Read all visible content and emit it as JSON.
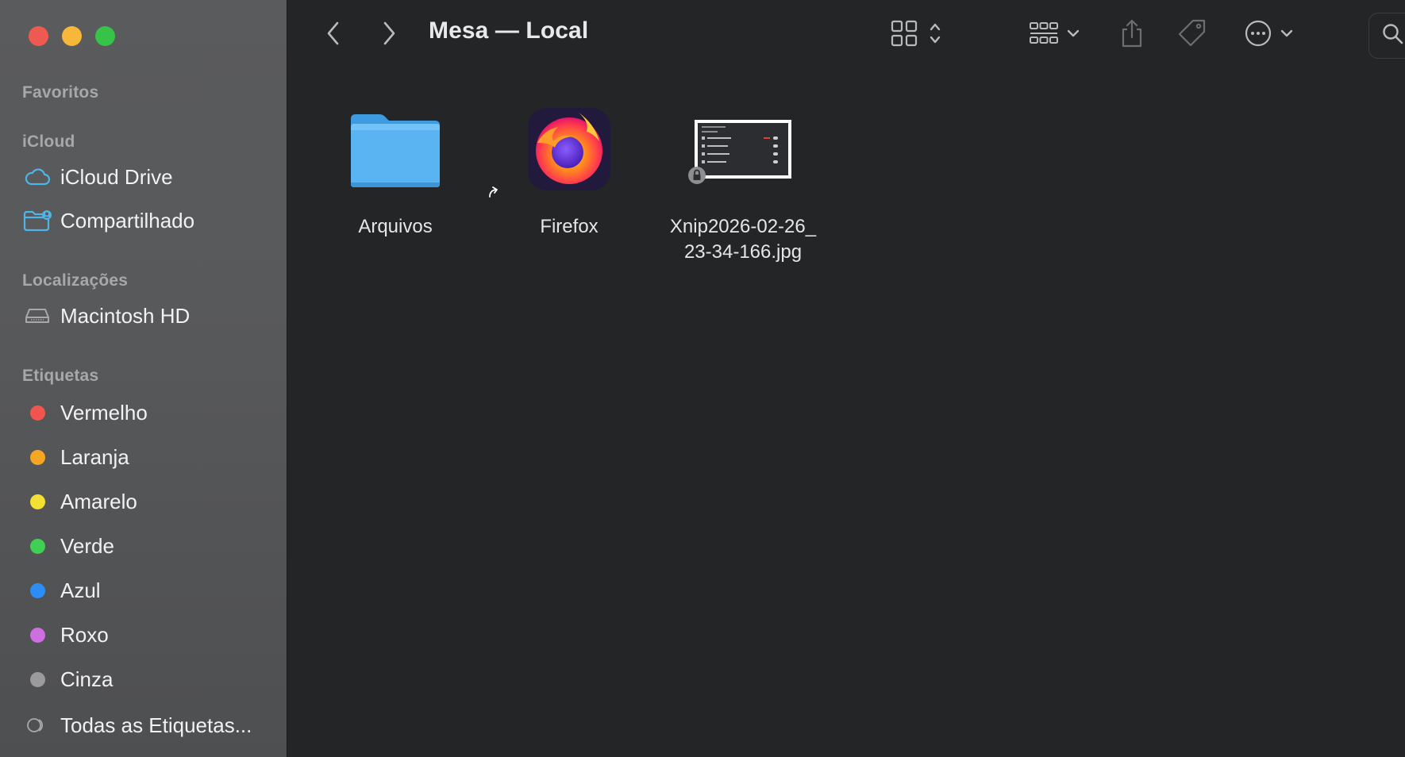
{
  "window": {
    "title": "Mesa — Local"
  },
  "colors": {
    "close": "#ee5a52",
    "minimize": "#f6b73b",
    "maximize": "#37c348",
    "accent_icloud": "#4fb4e6"
  },
  "sidebar": {
    "sections": {
      "favorites": "Favoritos",
      "icloud": "iCloud",
      "locations": "Localizações",
      "tags": "Etiquetas"
    },
    "icloud_items": [
      {
        "label": "iCloud Drive",
        "icon": "cloud-icon"
      },
      {
        "label": "Compartilhado",
        "icon": "shared-folder-icon"
      }
    ],
    "location_items": [
      {
        "label": "Macintosh HD",
        "icon": "hard-drive-icon"
      }
    ],
    "tag_items": [
      {
        "label": "Vermelho",
        "color": "#f0564e"
      },
      {
        "label": "Laranja",
        "color": "#f5a623"
      },
      {
        "label": "Amarelo",
        "color": "#f3e032"
      },
      {
        "label": "Verde",
        "color": "#3fcf55"
      },
      {
        "label": "Azul",
        "color": "#2c8ef5"
      },
      {
        "label": "Roxo",
        "color": "#cf6ee0"
      },
      {
        "label": "Cinza",
        "color": "#9b9b9d"
      }
    ],
    "all_tags": "Todas as Etiquetas..."
  },
  "toolbar": {
    "icons": [
      "back-icon",
      "forward-icon",
      "grid-view-icon",
      "group-icon",
      "share-icon",
      "tag-icon",
      "more-icon",
      "search-icon"
    ]
  },
  "files": [
    {
      "name_line1": "Arquivos",
      "name_line2": "",
      "type": "folder"
    },
    {
      "name_line1": "Firefox",
      "name_line2": "",
      "type": "app-alias"
    },
    {
      "name_line1": "Xnip2026-02-26_",
      "name_line2": "23-34-166.jpg",
      "type": "image"
    }
  ]
}
